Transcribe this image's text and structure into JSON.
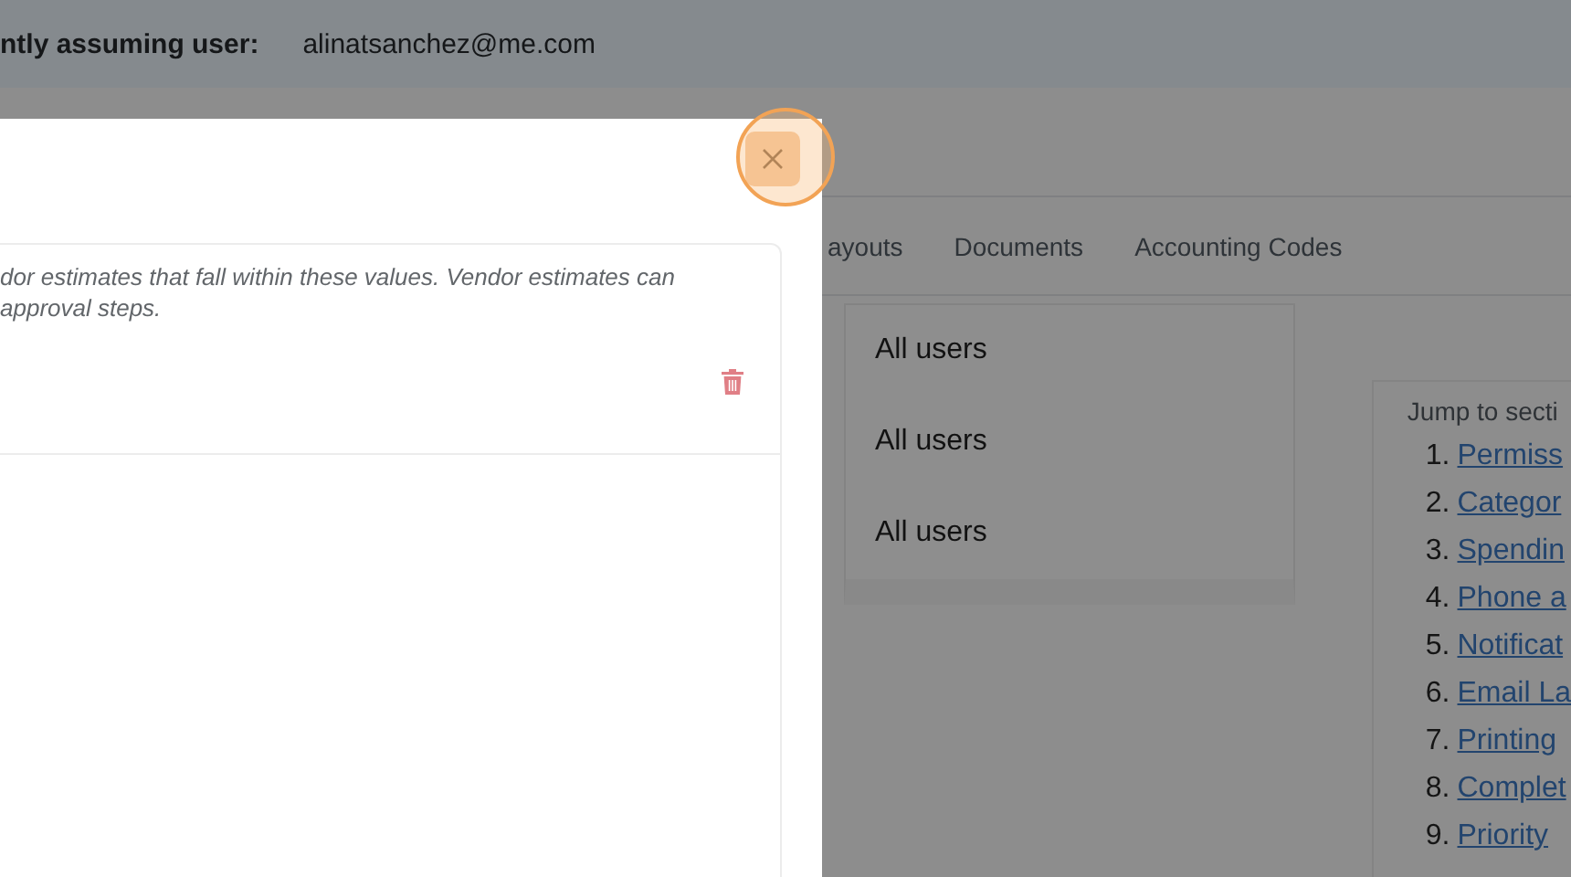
{
  "top_bar": {
    "label": "ntly assuming user:",
    "user": "alinatsanchez@me.com"
  },
  "tabs": [
    {
      "label": "ayouts",
      "selected": false
    },
    {
      "label": "Documents",
      "selected": false
    },
    {
      "label": "Accounting Codes",
      "selected": false
    }
  ],
  "table": {
    "rows": [
      {
        "cell": "All users"
      },
      {
        "cell": "All users"
      },
      {
        "cell": "All users"
      }
    ]
  },
  "jump_to_section": {
    "title": "Jump to secti",
    "links": [
      {
        "number": "1.",
        "label": "Permiss"
      },
      {
        "number": "2.",
        "label": "Categor"
      },
      {
        "number": "3.",
        "label": "Spendin"
      },
      {
        "number": "4.",
        "label": "Phone a"
      },
      {
        "number": "5.",
        "label": "Notificat"
      },
      {
        "number": "6.",
        "label": "Email La"
      },
      {
        "number": "7.",
        "label": "Printing"
      },
      {
        "number": "8.",
        "label": "Complet"
      },
      {
        "number": "9.",
        "label": "Priority"
      }
    ]
  },
  "modal": {
    "close_highlighted": true,
    "description": [
      "dor estimates that fall within these values. Vendor estimates can",
      "approval steps."
    ]
  }
}
